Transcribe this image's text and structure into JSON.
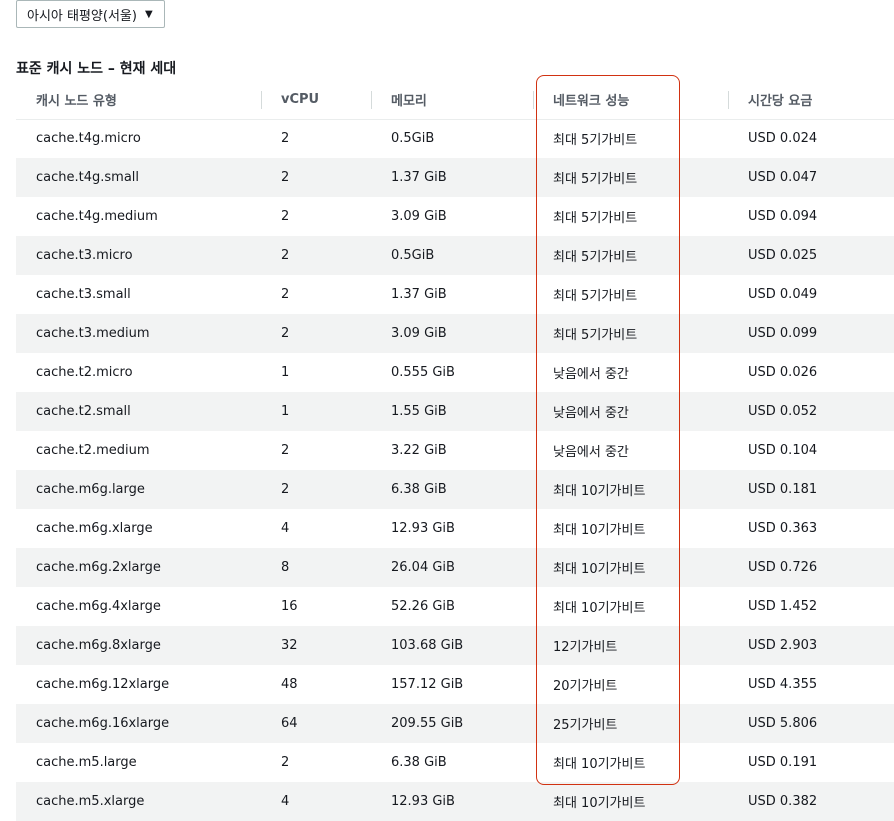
{
  "region_selector": {
    "value": "아시아 태평양(서울)"
  },
  "section_title": "표준 캐시 노드 – 현재 세대",
  "table": {
    "headers": [
      "캐시 노드 유형",
      "vCPU",
      "메모리",
      "네트워크 성능",
      "시간당 요금"
    ],
    "rows": [
      [
        "cache.t4g.micro",
        "2",
        "0.5GiB",
        "최대 5기가비트",
        "USD 0.024"
      ],
      [
        "cache.t4g.small",
        "2",
        "1.37 GiB",
        "최대 5기가비트",
        "USD 0.047"
      ],
      [
        "cache.t4g.medium",
        "2",
        "3.09 GiB",
        "최대 5기가비트",
        "USD 0.094"
      ],
      [
        "cache.t3.micro",
        "2",
        "0.5GiB",
        "최대 5기가비트",
        "USD 0.025"
      ],
      [
        "cache.t3.small",
        "2",
        "1.37 GiB",
        "최대 5기가비트",
        "USD 0.049"
      ],
      [
        "cache.t3.medium",
        "2",
        "3.09 GiB",
        "최대 5기가비트",
        "USD 0.099"
      ],
      [
        "cache.t2.micro",
        "1",
        "0.555 GiB",
        "낮음에서 중간",
        "USD 0.026"
      ],
      [
        "cache.t2.small",
        "1",
        "1.55 GiB",
        "낮음에서 중간",
        "USD 0.052"
      ],
      [
        "cache.t2.medium",
        "2",
        "3.22 GiB",
        "낮음에서 중간",
        "USD 0.104"
      ],
      [
        "cache.m6g.large",
        "2",
        "6.38 GiB",
        "최대 10기가비트",
        "USD 0.181"
      ],
      [
        "cache.m6g.xlarge",
        "4",
        "12.93 GiB",
        "최대 10기가비트",
        "USD 0.363"
      ],
      [
        "cache.m6g.2xlarge",
        "8",
        "26.04 GiB",
        "최대 10기가비트",
        "USD 0.726"
      ],
      [
        "cache.m6g.4xlarge",
        "16",
        "52.26 GiB",
        "최대 10기가비트",
        "USD 1.452"
      ],
      [
        "cache.m6g.8xlarge",
        "32",
        "103.68 GiB",
        "12기가비트",
        "USD 2.903"
      ],
      [
        "cache.m6g.12xlarge",
        "48",
        "157.12 GiB",
        "20기가비트",
        "USD 4.355"
      ],
      [
        "cache.m6g.16xlarge",
        "64",
        "209.55 GiB",
        "25기가비트",
        "USD 5.806"
      ],
      [
        "cache.m5.large",
        "2",
        "6.38 GiB",
        "최대 10기가비트",
        "USD 0.191"
      ],
      [
        "cache.m5.xlarge",
        "4",
        "12.93 GiB",
        "최대 10기가비트",
        "USD 0.382"
      ]
    ]
  },
  "colors": {
    "highlight": "#d13212",
    "stripe": "#f2f3f3"
  }
}
